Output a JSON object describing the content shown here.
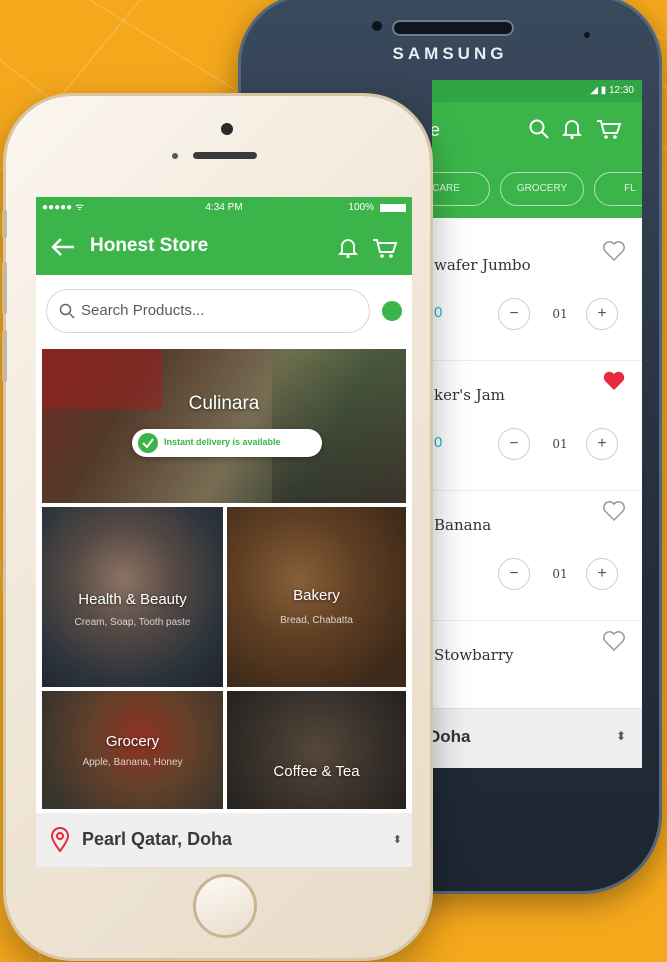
{
  "colors": {
    "accent_green": "#3BB54A",
    "background": "#F5A81C",
    "heart_red": "#E8283B",
    "price_teal": "#27b5c9"
  },
  "samsung": {
    "brand": "SAMSUNG",
    "status_time": "12:30",
    "header_title_fragment": "e",
    "header_icons": [
      "search-icon",
      "bell-icon",
      "cart-icon"
    ],
    "tabs": [
      "CARE",
      "GROCERY",
      "FL"
    ],
    "items": [
      {
        "name": "wafer Jumbo",
        "price": "0",
        "qty": "01",
        "favorite": false
      },
      {
        "name": "ker's Jam",
        "price": "0",
        "qty": "01",
        "favorite": true
      },
      {
        "name": "Banana",
        "price": "",
        "qty": "01",
        "favorite": false
      },
      {
        "name": "Stowbarry",
        "price": "",
        "qty": "",
        "favorite": false
      }
    ],
    "stepper": {
      "minus": "−",
      "plus": "+"
    },
    "footer_location": "Doha",
    "footer_arrow": "⬍"
  },
  "iphone": {
    "status": {
      "carrier": "●●●●● ᯤ",
      "time": "4:34 PM",
      "battery": "100%"
    },
    "header": {
      "title": "Honest Store",
      "back_icon": "arrow-left-icon"
    },
    "search": {
      "placeholder": "Search Products..."
    },
    "hero": {
      "title": "Culinara",
      "delivery_text": "Instant delivery is available"
    },
    "categories": [
      {
        "title": "Health & Beauty",
        "subtitle": "Cream, Soap, Tooth paste"
      },
      {
        "title": "Bakery",
        "subtitle": "Bread, Chabatta"
      },
      {
        "title": "Grocery",
        "subtitle": "Apple, Banana, Honey"
      },
      {
        "title": "Coffee & Tea",
        "subtitle": ""
      }
    ],
    "footer": {
      "location": "Pearl Qatar, Doha",
      "arrows": "⬍"
    }
  }
}
